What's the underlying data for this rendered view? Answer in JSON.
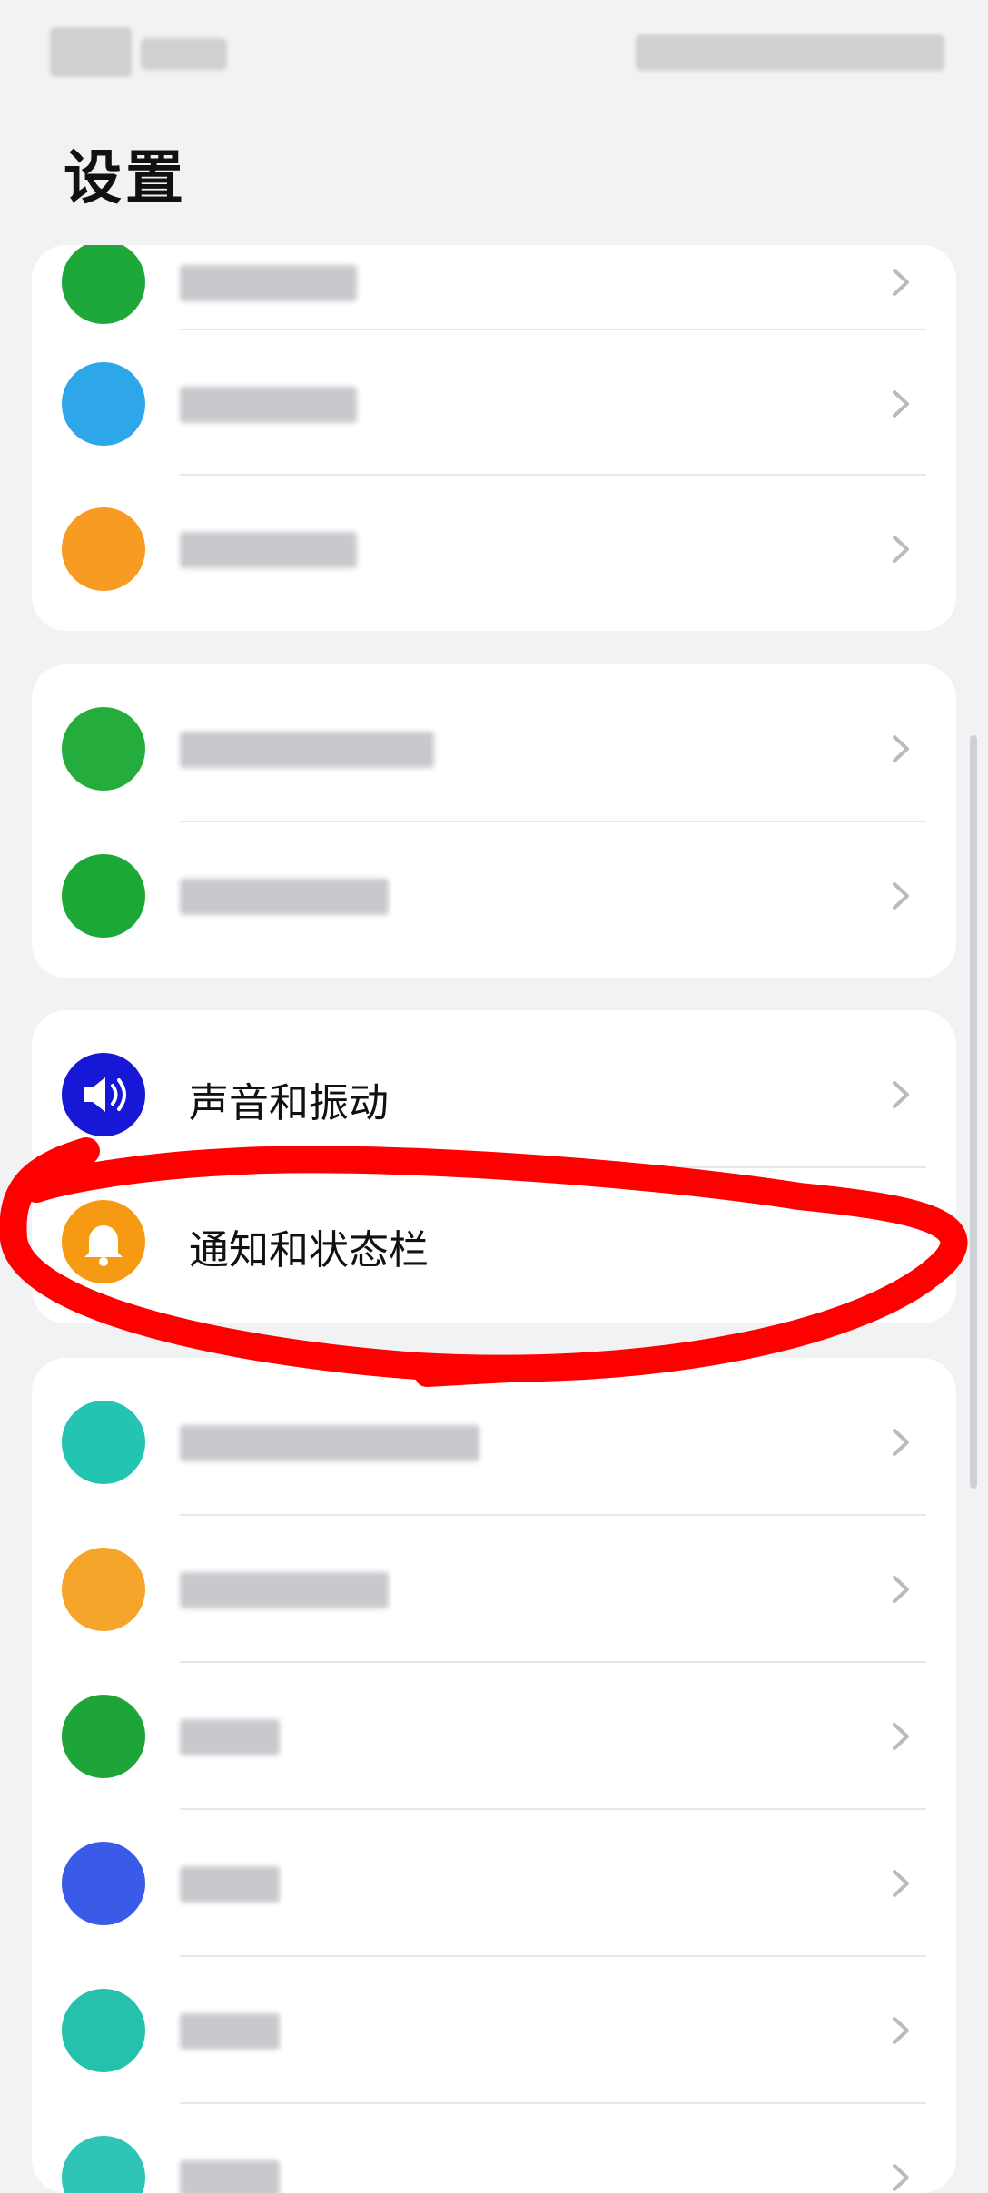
{
  "header": {
    "title": "设置"
  },
  "group_a": {
    "items": [
      {
        "label": ""
      },
      {
        "label": ""
      },
      {
        "label": ""
      }
    ]
  },
  "group_b": {
    "items": [
      {
        "label": ""
      },
      {
        "label": ""
      }
    ]
  },
  "group_c": {
    "items": [
      {
        "label": "声音和振动"
      },
      {
        "label": "通知和状态栏"
      }
    ]
  },
  "group_d": {
    "items": [
      {
        "label": ""
      },
      {
        "label": ""
      },
      {
        "label": ""
      },
      {
        "label": ""
      },
      {
        "label": ""
      },
      {
        "label": ""
      }
    ]
  },
  "colors": {
    "sound_icon": "#1717d6",
    "notification_icon": "#f59a12",
    "annotation": "#ff0000"
  },
  "icons": {
    "sound": "speaker-icon",
    "notification": "bell-icon"
  }
}
